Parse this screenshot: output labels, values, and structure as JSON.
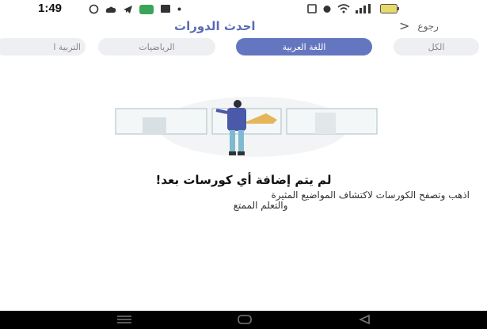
{
  "status_bar": {
    "time": "1:49",
    "battery_icon": "battery-icon",
    "wifi_icon": "wifi-icon",
    "signal_icon": "signal-icon"
  },
  "header": {
    "title": "احدث الدورات",
    "back_label": "رجوع",
    "back_icon": "chevron-left-icon"
  },
  "tabs": [
    {
      "label": "الكل",
      "active": false
    },
    {
      "label": "اللغة العربية",
      "active": true
    },
    {
      "label": "الرياضيات",
      "active": false
    },
    {
      "label": "التربية ا",
      "active": false
    }
  ],
  "empty_state": {
    "heading": "لم يتم إضافة أي كورسات بعد!",
    "description_line1": "اذهب وتصفح الكورسات لاكتشاف المواضيع المثيرة",
    "description_line2": "والتعلم الممتع"
  },
  "navbar": {
    "icons": [
      "menu-icon",
      "home-icon",
      "back-icon"
    ]
  },
  "colors": {
    "accent": "#6576c0",
    "title": "#5a6bb5",
    "tab_bg": "#eeeff2"
  }
}
